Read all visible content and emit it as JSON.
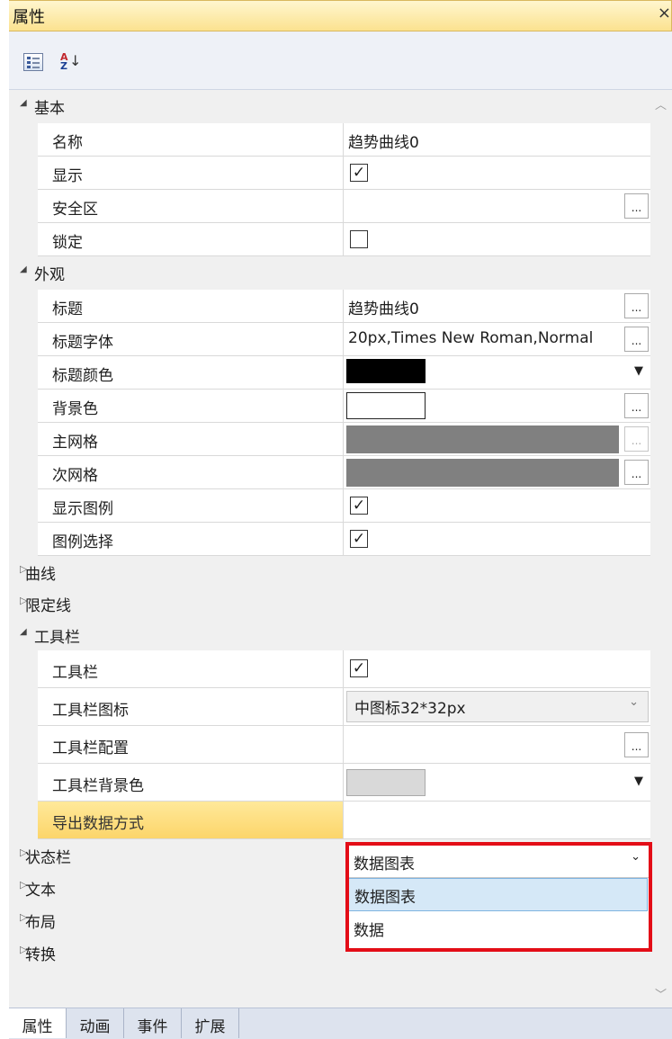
{
  "panel": {
    "title": "属性",
    "close_glyph": "×"
  },
  "toolbar": {
    "categorized_icon": "categorized-view-icon",
    "sort_icon": "sort-az-icon"
  },
  "groups": {
    "basic": {
      "label": "基本",
      "props": {
        "name": {
          "label": "名称",
          "value": "趋势曲线0"
        },
        "visible": {
          "label": "显示",
          "checked": true,
          "mark": "✓"
        },
        "safe_zone": {
          "label": "安全区",
          "value": "",
          "ellipsis": "..."
        },
        "locked": {
          "label": "锁定",
          "checked": false,
          "mark": ""
        }
      }
    },
    "appearance": {
      "label": "外观",
      "props": {
        "title": {
          "label": "标题",
          "value": "趋势曲线0",
          "ellipsis": "..."
        },
        "title_font": {
          "label": "标题字体",
          "value": "20px,Times New Roman,Normal",
          "ellipsis": "..."
        },
        "title_color": {
          "label": "标题颜色",
          "color": "#000000"
        },
        "background": {
          "label": "背景色",
          "color": "#ffffff",
          "ellipsis": "..."
        },
        "major_grid": {
          "label": "主网格",
          "color": "#808080",
          "ellipsis": "..."
        },
        "minor_grid": {
          "label": "次网格",
          "color": "#808080",
          "ellipsis": "..."
        },
        "show_legend": {
          "label": "显示图例",
          "checked": true,
          "mark": "✓"
        },
        "legend_select": {
          "label": "图例选择",
          "checked": true,
          "mark": "✓"
        }
      }
    },
    "curve": {
      "label": "曲线"
    },
    "limit_line": {
      "label": "限定线"
    },
    "toolbar_group": {
      "label": "工具栏",
      "props": {
        "toolbar": {
          "label": "工具栏",
          "checked": true,
          "mark": "✓"
        },
        "toolbar_icon": {
          "label": "工具栏图标",
          "value": "中图标32*32px"
        },
        "toolbar_config": {
          "label": "工具栏配置",
          "value": "",
          "ellipsis": "..."
        },
        "toolbar_bg": {
          "label": "工具栏背景色",
          "color": "#d9d9d9"
        },
        "export_mode": {
          "label": "导出数据方式",
          "value": "数据图表",
          "selected": true
        }
      }
    },
    "statusbar": {
      "label": "状态栏"
    },
    "text": {
      "label": "文本"
    },
    "layout": {
      "label": "布局"
    },
    "transform": {
      "label": "转换"
    }
  },
  "dropdown": {
    "open": true,
    "highlight_color": "#e30d17",
    "options": [
      "数据图表",
      "数据"
    ],
    "selected_index": 0
  },
  "tabs": [
    {
      "label": "属性",
      "active": true
    },
    {
      "label": "动画",
      "active": false
    },
    {
      "label": "事件",
      "active": false
    },
    {
      "label": "扩展",
      "active": false
    }
  ]
}
